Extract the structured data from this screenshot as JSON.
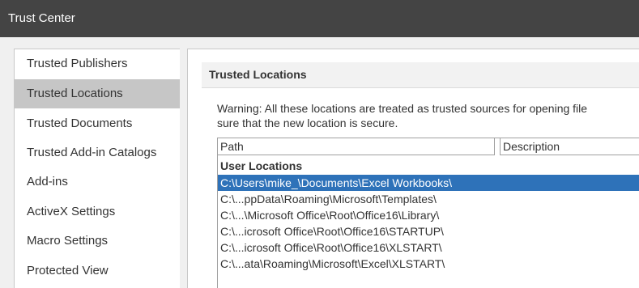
{
  "window": {
    "title": "Trust Center"
  },
  "sidebar": {
    "items": [
      {
        "label": "Trusted Publishers",
        "selected": false
      },
      {
        "label": "Trusted Locations",
        "selected": true
      },
      {
        "label": "Trusted Documents",
        "selected": false
      },
      {
        "label": "Trusted Add-in Catalogs",
        "selected": false
      },
      {
        "label": "Add-ins",
        "selected": false
      },
      {
        "label": "ActiveX Settings",
        "selected": false
      },
      {
        "label": "Macro Settings",
        "selected": false
      },
      {
        "label": "Protected View",
        "selected": false
      }
    ]
  },
  "main": {
    "section_title": "Trusted Locations",
    "warning_line1": "Warning: All these locations are treated as trusted sources for opening file",
    "warning_line2": "sure that the new location is secure.",
    "table": {
      "columns": [
        "Path",
        "Description"
      ],
      "group_label": "User Locations",
      "rows": [
        {
          "path": "C:\\Users\\mike_\\Documents\\Excel Workbooks\\",
          "selected": true
        },
        {
          "path": "C:\\...ppData\\Roaming\\Microsoft\\Templates\\",
          "selected": false
        },
        {
          "path": "C:\\...\\Microsoft Office\\Root\\Office16\\Library\\",
          "selected": false
        },
        {
          "path": "C:\\...icrosoft Office\\Root\\Office16\\STARTUP\\",
          "selected": false
        },
        {
          "path": "C:\\...icrosoft Office\\Root\\Office16\\XLSTART\\",
          "selected": false
        },
        {
          "path": "C:\\...ata\\Roaming\\Microsoft\\Excel\\XLSTART\\",
          "selected": false
        }
      ]
    }
  },
  "colors": {
    "titlebar_bg": "#444444",
    "selected_sidebar_bg": "#c6c6c6",
    "selected_row_bg": "#2e72b9"
  }
}
